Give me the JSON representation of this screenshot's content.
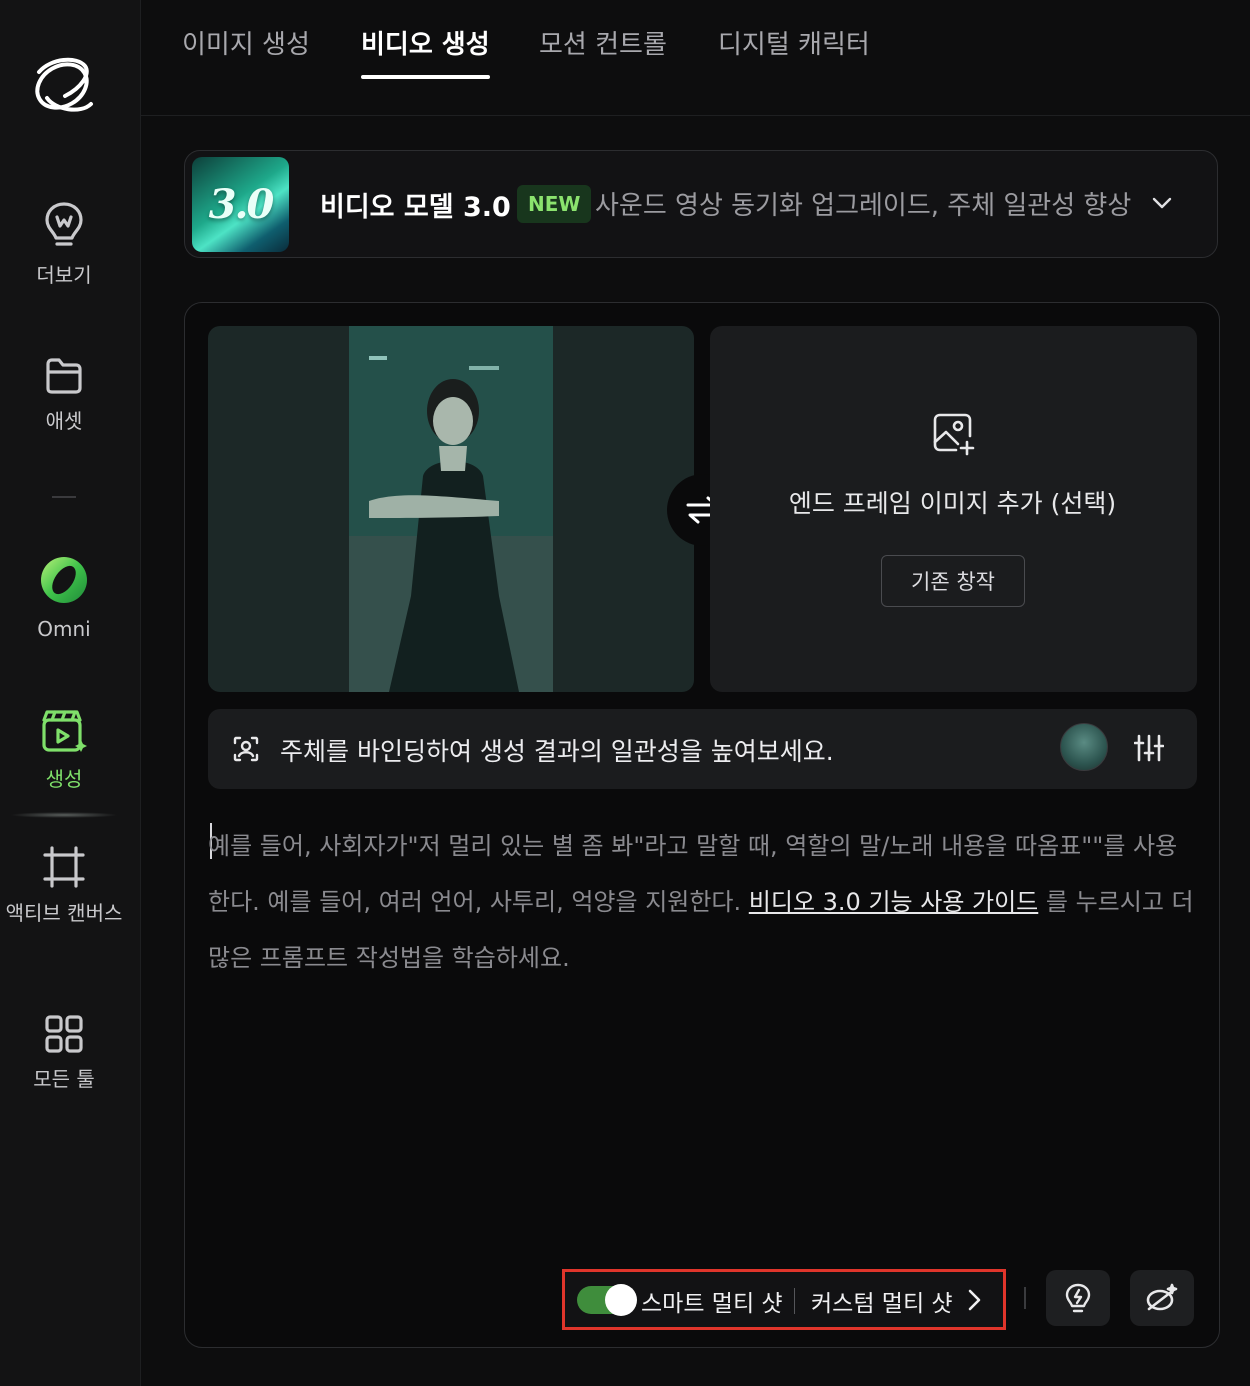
{
  "sidebar": {
    "items": [
      {
        "label": "더보기",
        "icon": "lightbulb-icon"
      },
      {
        "label": "애셋",
        "icon": "folder-icon"
      },
      {
        "label": "Omni",
        "icon": "omni-ring-icon"
      },
      {
        "label": "생성",
        "icon": "create-clapper-icon",
        "active": true
      },
      {
        "label": "액티브 캔버스",
        "icon": "canvas-frame-icon"
      },
      {
        "label": "모든 툴",
        "icon": "grid-icon"
      }
    ],
    "active_color": "#7fe06a"
  },
  "tabs": [
    {
      "label": "이미지 생성"
    },
    {
      "label": "비디오 생성",
      "active": true
    },
    {
      "label": "모션 컨트롤"
    },
    {
      "label": "디지털 캐릭터"
    }
  ],
  "model": {
    "thumb_text": "3.0",
    "name": "비디오 모델 3.0",
    "badge": "NEW",
    "description": "사운드 영상 동기화 업그레이드, 주체 일관성 향상"
  },
  "frames": {
    "end_frame_text": "엔드 프레임 이미지 추가 (선택)",
    "create_button": "기존 창작"
  },
  "subject": {
    "text": "주체를 바인딩하여 생성 결과의 일관성을 높여보세요."
  },
  "prompt": {
    "placeholder_before": "예를 들어, 사회자가\"저 멀리 있는 별 좀 봐\"라고 말할 때, 역할의 말/노래 내용을 따옴표\"\"를 사용한다. 예를 들어, 여러 언어, 사투리, 억양을 지원한다. ",
    "guide_link": "비디오 3.0 기능 사용 가이드",
    "placeholder_after": " 를 누르시고 더 많은 프롬프트 작성법을 학습하세요."
  },
  "controls": {
    "smart_multishot": "스마트 멀티 샷",
    "smart_multishot_on": true,
    "custom_multishot": "커스텀 멀티 샷",
    "highlight_color": "#e0352b",
    "toggle_color": "#3f8d3c"
  }
}
